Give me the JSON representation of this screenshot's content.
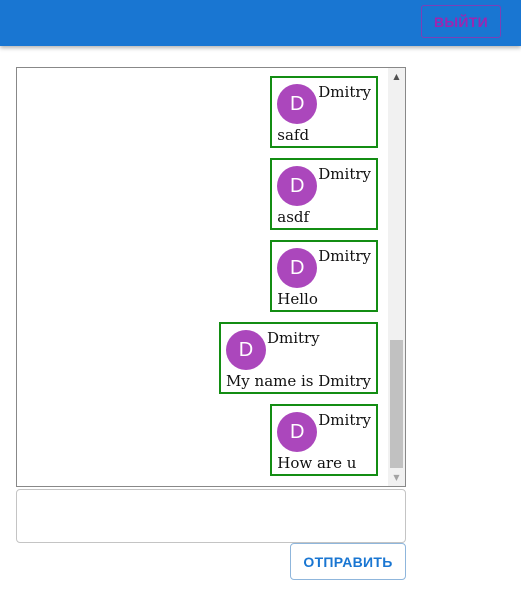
{
  "header": {
    "logout_label": "ВЫЙТИ"
  },
  "chat": {
    "messages": [
      {
        "author": "Dmitry",
        "avatar_letter": "D",
        "text": "safd"
      },
      {
        "author": "Dmitry",
        "avatar_letter": "D",
        "text": "asdf"
      },
      {
        "author": "Dmitry",
        "avatar_letter": "D",
        "text": "Hello"
      },
      {
        "author": "Dmitry",
        "avatar_letter": "D",
        "text": "My name is Dmitry"
      },
      {
        "author": "Dmitry",
        "avatar_letter": "D",
        "text": "How are u"
      }
    ]
  },
  "composer": {
    "input_value": "",
    "send_label": "ОТПРАВИТЬ"
  },
  "icons": {
    "scroll_up": "triangle-up-icon",
    "scroll_down": "triangle-down-icon"
  },
  "colors": {
    "appbar": "#1976d2",
    "logout_text": "#9c27b0",
    "avatar": "#ab47bc",
    "message_border": "#138d13",
    "send_text": "#1976d2"
  }
}
